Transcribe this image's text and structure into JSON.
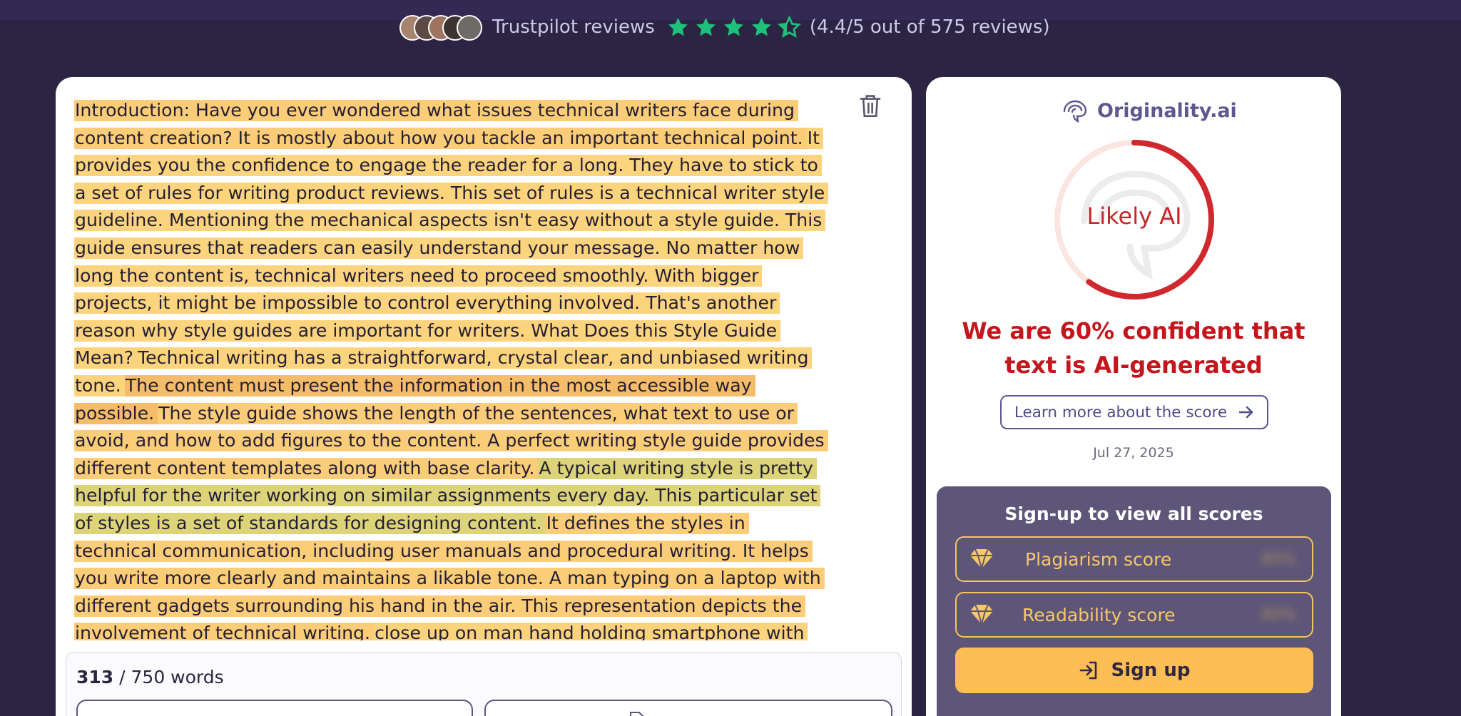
{
  "trustbar": {
    "label": "Trustpilot reviews",
    "rating_text": "(4.4/5 out of 575 reviews)",
    "rating": 4.4,
    "star_color": "#1fbf7c"
  },
  "editor": {
    "segments": [
      {
        "text": "Introduction: Have you ever wondered what issues technical writers face during content creation? It is mostly about how you tackle an important technical point.",
        "tone": "a"
      },
      {
        "text": "It provides you the confidence to engage the reader for a long. They have to stick to a set of rules for writing product reviews. This set of rules is a technical writer style guideline. Mentioning the mechanical aspects isn't easy without a style guide. This guide ensures that readers can easily understand your message. No matter how long the content is, technical writers need to proceed smoothly. With bigger projects, it might be impossible to control everything involved. That's another reason why style guides are important for writers. What Does this Style Guide Mean?",
        "tone": "b"
      },
      {
        "text": "Technical writing has a straightforward, crystal clear, and unbiased writing tone.",
        "tone": "b"
      },
      {
        "text": "The content must present the information in the most accessible way possible.",
        "tone": "c"
      },
      {
        "text": "The style guide shows the length of the sentences, what text to use or avoid, and how to add figures to the content. A perfect writing style guide provides different content templates along with base clarity.",
        "tone": "a"
      },
      {
        "text": "A typical writing style is pretty helpful for the writer working on similar assignments every day. This particular set of styles is a set of standards for designing content.",
        "tone": "d"
      },
      {
        "text": "It defines the styles in technical communication, including user manuals and procedural writing. It helps you write more clearly and maintains a likable tone. A man typing on a laptop with different gadgets surrounding his hand in the air. This representation depicts the involvement of technical writing.",
        "tone": "a"
      },
      {
        "text": "close up on man hand holding smartphone with futuristic social media marketing icon for internet network technology and business concept Our Top Picks for Different Styles: The technical style guide provides",
        "tone": "e"
      }
    ],
    "word_count": "313",
    "word_limit": "/ 750 words"
  },
  "score": {
    "brand": "Originality.ai",
    "gauge_label": "Likely AI",
    "ai_confidence_pct": 60,
    "confidence_text": "We are 60% confident that text is AI-generated",
    "learn_more": "Learn more about the score",
    "date": "Jul 27, 2025",
    "signup_title": "Sign-up to view all scores",
    "plagiarism_label": "Plagiarism score",
    "plagiarism_value": "80%",
    "readability_label": "Readability score",
    "readability_value": "80%",
    "signup_button": "Sign up",
    "accent": "#c3161d",
    "cta_color": "#ffbe55"
  }
}
